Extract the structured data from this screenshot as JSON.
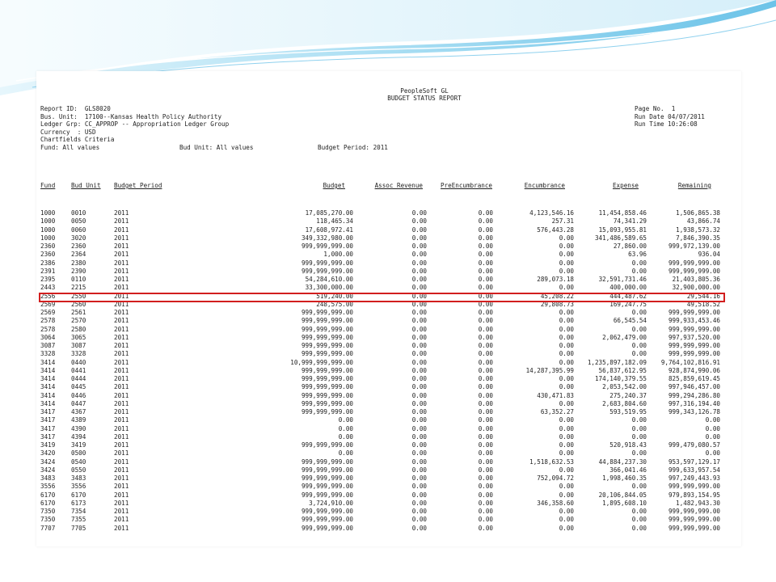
{
  "report": {
    "system_title": "PeopleSoft GL",
    "report_title": "BUDGET STATUS REPORT",
    "left_header": [
      "Report ID:  GLS8020",
      "Bus. Unit:  17100--Kansas Health Policy Authority",
      "Ledger Grp: CC_APPROP -- Appropriation Ledger Group",
      "Currency  : USD",
      "Chartfields Criteria",
      "Fund: All values"
    ],
    "bud_unit_criteria": "Bud Unit: All values",
    "budget_period_criteria": "Budget Period: 2011",
    "right_header": [
      "Page No.  1",
      "Run Date 04/07/2011",
      "Run Time 10:26:08"
    ],
    "columns": [
      "Fund",
      "Bud Unit",
      "Budget Period",
      "Budget",
      "Assoc Revenue",
      "PreEncumbrance",
      "Encumbrance",
      "Expense",
      "Remaining"
    ],
    "rows": [
      [
        "1000",
        "0010",
        "2011",
        "17,085,270.00",
        "0.00",
        "0.00",
        "4,123,546.16",
        "11,454,858.46",
        "1,506,865.38"
      ],
      [
        "1000",
        "0050",
        "2011",
        "118,465.34",
        "0.00",
        "0.00",
        "257.31",
        "74,341.29",
        "43,866.74"
      ],
      [
        "1000",
        "0060",
        "2011",
        "17,608,972.41",
        "0.00",
        "0.00",
        "576,443.28",
        "15,093,955.81",
        "1,938,573.32"
      ],
      [
        "1000",
        "3020",
        "2011",
        "349,332,980.00",
        "0.00",
        "0.00",
        "0.00",
        "341,486,589.65",
        "7,846,390.35"
      ],
      [
        "2360",
        "2360",
        "2011",
        "999,999,999.00",
        "0.00",
        "0.00",
        "0.00",
        "27,860.00",
        "999,972,139.00"
      ],
      [
        "2360",
        "2364",
        "2011",
        "1,000.00",
        "0.00",
        "0.00",
        "0.00",
        "63.96",
        "936.04"
      ],
      [
        "2386",
        "2380",
        "2011",
        "999,999,999.00",
        "0.00",
        "0.00",
        "0.00",
        "0.00",
        "999,999,999.00"
      ],
      [
        "2391",
        "2390",
        "2011",
        "999,999,999.00",
        "0.00",
        "0.00",
        "0.00",
        "0.00",
        "999,999,999.00"
      ],
      [
        "2395",
        "0110",
        "2011",
        "54,284,610.00",
        "0.00",
        "0.00",
        "289,073.18",
        "32,591,731.46",
        "21,403,805.36"
      ],
      [
        "2443",
        "2215",
        "2011",
        "33,300,000.00",
        "0.00",
        "0.00",
        "0.00",
        "400,000.00",
        "32,900,000.00"
      ],
      [
        "2556",
        "2550",
        "2011",
        "519,240.00",
        "0.00",
        "0.00",
        "45,208.22",
        "444,487.62",
        "29,544.16"
      ],
      [
        "2569",
        "2560",
        "2011",
        "248,575.00",
        "0.00",
        "0.00",
        "29,808.73",
        "169,247.75",
        "49,518.52"
      ],
      [
        "2569",
        "2561",
        "2011",
        "999,999,999.00",
        "0.00",
        "0.00",
        "0.00",
        "0.00",
        "999,999,999.00"
      ],
      [
        "2578",
        "2570",
        "2011",
        "999,999,999.00",
        "0.00",
        "0.00",
        "0.00",
        "66,545.54",
        "999,933,453.46"
      ],
      [
        "2578",
        "2580",
        "2011",
        "999,999,999.00",
        "0.00",
        "0.00",
        "0.00",
        "0.00",
        "999,999,999.00"
      ],
      [
        "3064",
        "3065",
        "2011",
        "999,999,999.00",
        "0.00",
        "0.00",
        "0.00",
        "2,062,479.00",
        "997,937,520.00"
      ],
      [
        "3087",
        "3087",
        "2011",
        "999,999,999.00",
        "0.00",
        "0.00",
        "0.00",
        "0.00",
        "999,999,999.00"
      ],
      [
        "3328",
        "3328",
        "2011",
        "999,999,999.00",
        "0.00",
        "0.00",
        "0.00",
        "0.00",
        "999,999,999.00"
      ],
      [
        "3414",
        "0440",
        "2011",
        "10,999,999,999.00",
        "0.00",
        "0.00",
        "0.00",
        "1,235,897,182.09",
        "9,764,102,816.91"
      ],
      [
        "3414",
        "0441",
        "2011",
        "999,999,999.00",
        "0.00",
        "0.00",
        "14,287,395.99",
        "56,837,612.95",
        "928,874,990.06"
      ],
      [
        "3414",
        "0444",
        "2011",
        "999,999,999.00",
        "0.00",
        "0.00",
        "0.00",
        "174,140,379.55",
        "825,859,619.45"
      ],
      [
        "3414",
        "0445",
        "2011",
        "999,999,999.00",
        "0.00",
        "0.00",
        "0.00",
        "2,053,542.00",
        "997,946,457.00"
      ],
      [
        "3414",
        "0446",
        "2011",
        "999,999,999.00",
        "0.00",
        "0.00",
        "430,471.83",
        "275,240.37",
        "999,294,286.80"
      ],
      [
        "3414",
        "0447",
        "2011",
        "999,999,999.00",
        "0.00",
        "0.00",
        "0.00",
        "2,683,804.60",
        "997,316,194.40"
      ],
      [
        "3417",
        "4367",
        "2011",
        "999,999,999.00",
        "0.00",
        "0.00",
        "63,352.27",
        "593,519.95",
        "999,343,126.78"
      ],
      [
        "3417",
        "4389",
        "2011",
        "0.00",
        "0.00",
        "0.00",
        "0.00",
        "0.00",
        "0.00"
      ],
      [
        "3417",
        "4390",
        "2011",
        "0.00",
        "0.00",
        "0.00",
        "0.00",
        "0.00",
        "0.00"
      ],
      [
        "3417",
        "4394",
        "2011",
        "0.00",
        "0.00",
        "0.00",
        "0.00",
        "0.00",
        "0.00"
      ],
      [
        "3419",
        "3419",
        "2011",
        "999,999,999.00",
        "0.00",
        "0.00",
        "0.00",
        "520,918.43",
        "999,479,080.57"
      ],
      [
        "3420",
        "0500",
        "2011",
        "0.00",
        "0.00",
        "0.00",
        "0.00",
        "0.00",
        "0.00"
      ],
      [
        "3424",
        "0540",
        "2011",
        "999,999,999.00",
        "0.00",
        "0.00",
        "1,518,632.53",
        "44,884,237.30",
        "953,597,129.17"
      ],
      [
        "3424",
        "0550",
        "2011",
        "999,999,999.00",
        "0.00",
        "0.00",
        "0.00",
        "366,041.46",
        "999,633,957.54"
      ],
      [
        "3483",
        "3483",
        "2011",
        "999,999,999.00",
        "0.00",
        "0.00",
        "752,094.72",
        "1,998,460.35",
        "997,249,443.93"
      ],
      [
        "3556",
        "3556",
        "2011",
        "999,999,999.00",
        "0.00",
        "0.00",
        "0.00",
        "0.00",
        "999,999,999.00"
      ],
      [
        "6170",
        "6170",
        "2011",
        "999,999,999.00",
        "0.00",
        "0.00",
        "0.00",
        "20,106,844.05",
        "979,893,154.95"
      ],
      [
        "6170",
        "6173",
        "2011",
        "3,724,910.00",
        "0.00",
        "0.00",
        "346,358.60",
        "1,895,608.10",
        "1,482,943.30"
      ],
      [
        "7350",
        "7354",
        "2011",
        "999,999,999.00",
        "0.00",
        "0.00",
        "0.00",
        "0.00",
        "999,999,999.00"
      ],
      [
        "7350",
        "7355",
        "2011",
        "999,999,999.00",
        "0.00",
        "0.00",
        "0.00",
        "0.00",
        "999,999,999.00"
      ],
      [
        "7707",
        "7705",
        "2011",
        "999,999,999.00",
        "0.00",
        "0.00",
        "0.00",
        "0.00",
        "999,999,999.00"
      ]
    ],
    "highlighted_row_index": 10
  },
  "colors": {
    "highlight": "#d21f1f",
    "swoosh_light": "#bfe6f6",
    "swoosh_dark": "#5ab8e0"
  }
}
